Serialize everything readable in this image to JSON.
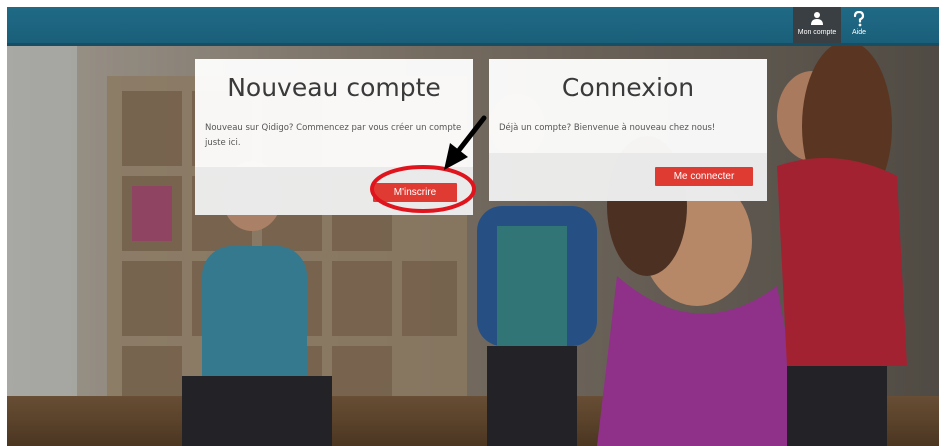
{
  "header": {
    "account_label": "Mon compte",
    "help_label": "Aide",
    "account_icon": "user-icon",
    "help_icon": "question-icon"
  },
  "new_account": {
    "title": "Nouveau compte",
    "text": "Nouveau sur Qidigo? Commencez par vous créer un compte juste ici.",
    "button": "M'inscrire"
  },
  "login": {
    "title": "Connexion",
    "text": "Déjà un compte? Bienvenue à nouveau chez nous!",
    "button": "Me connecter"
  },
  "colors": {
    "header": "#1a5f7a",
    "button": "#e03b33",
    "highlight": "#e0141d"
  }
}
